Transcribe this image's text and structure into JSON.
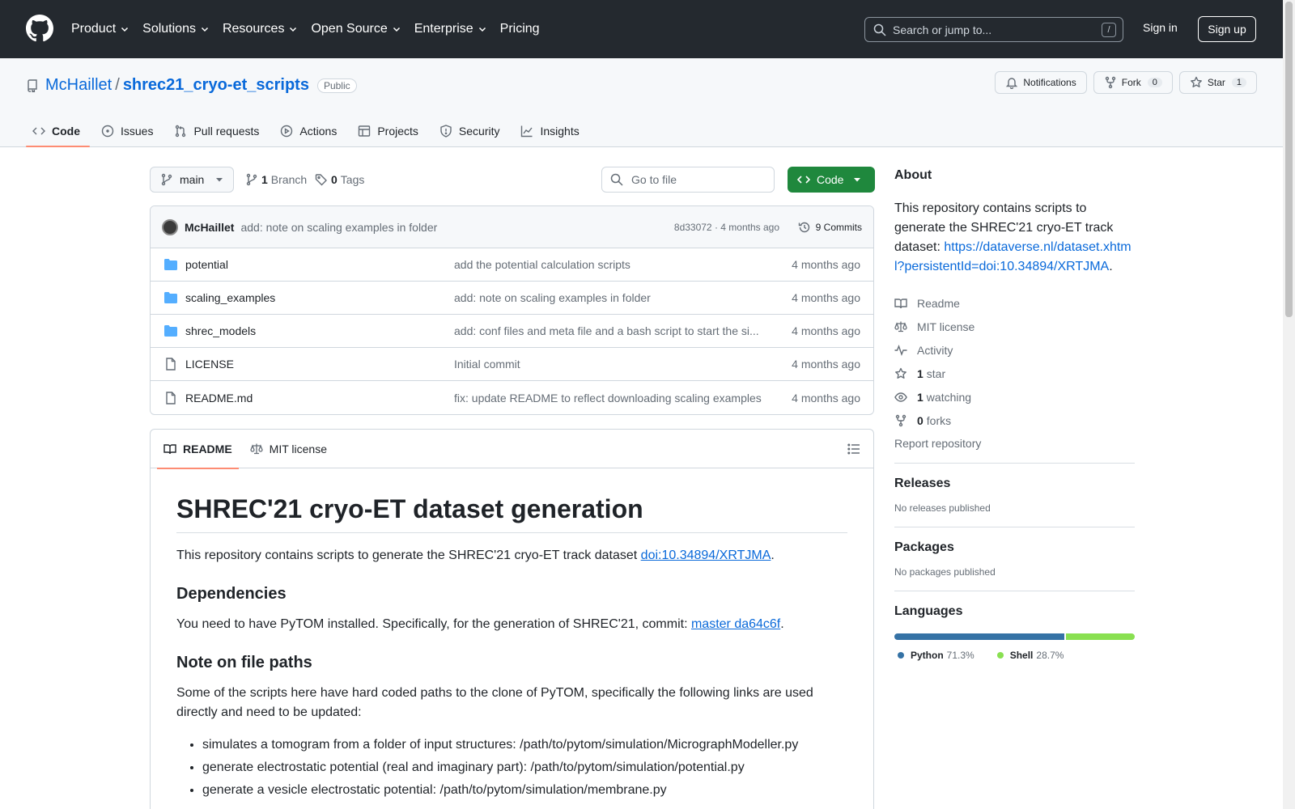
{
  "header": {
    "nav": [
      {
        "label": "Product",
        "dropdown": true
      },
      {
        "label": "Solutions",
        "dropdown": true
      },
      {
        "label": "Resources",
        "dropdown": true
      },
      {
        "label": "Open Source",
        "dropdown": true
      },
      {
        "label": "Enterprise",
        "dropdown": true
      },
      {
        "label": "Pricing",
        "dropdown": false
      }
    ],
    "search_placeholder": "Search or jump to...",
    "search_shortcut": "/",
    "sign_in": "Sign in",
    "sign_up": "Sign up"
  },
  "repo": {
    "owner": "McHaillet",
    "separator": "/",
    "name": "shrec21_cryo-et_scripts",
    "visibility": "Public",
    "actions": {
      "notifications": "Notifications",
      "fork_label": "Fork",
      "fork_count": "0",
      "star_label": "Star",
      "star_count": "1"
    },
    "tabs": [
      {
        "label": "Code",
        "icon": "code-icon",
        "active": true
      },
      {
        "label": "Issues",
        "icon": "issue-icon",
        "active": false
      },
      {
        "label": "Pull requests",
        "icon": "pull-request-icon",
        "active": false
      },
      {
        "label": "Actions",
        "icon": "play-icon",
        "active": false
      },
      {
        "label": "Projects",
        "icon": "table-icon",
        "active": false
      },
      {
        "label": "Security",
        "icon": "shield-icon",
        "active": false
      },
      {
        "label": "Insights",
        "icon": "graph-icon",
        "active": false
      }
    ]
  },
  "filebar": {
    "branch": "main",
    "branch_count": "1",
    "branch_label": "Branch",
    "tag_count": "0",
    "tag_label": "Tags",
    "go_to_file": "Go to file",
    "code_button": "Code"
  },
  "latest_commit": {
    "author": "McHaillet",
    "message": "add: note on scaling examples in folder",
    "hash_age": "8d33072 · 4 months ago",
    "commits": "9 Commits"
  },
  "files": [
    {
      "name": "potential",
      "type": "folder",
      "commit": "add the potential calculation scripts",
      "age": "4 months ago"
    },
    {
      "name": "scaling_examples",
      "type": "folder",
      "commit": "add: note on scaling examples in folder",
      "age": "4 months ago"
    },
    {
      "name": "shrec_models",
      "type": "folder",
      "commit": "add: conf files and meta file and a bash script to start the si...",
      "age": "4 months ago"
    },
    {
      "name": "LICENSE",
      "type": "file",
      "commit": "Initial commit",
      "age": "4 months ago"
    },
    {
      "name": "README.md",
      "type": "file",
      "commit": "fix: update README to reflect downloading scaling examples",
      "age": "4 months ago"
    }
  ],
  "readme": {
    "tab_readme": "README",
    "tab_license": "MIT license",
    "title": "SHREC'21 cryo-ET dataset generation",
    "intro_text": "This repository contains scripts to generate the SHREC'21 cryo-ET track dataset ",
    "intro_link": "doi:10.34894/XRTJMA",
    "intro_end": ".",
    "h_dependencies": "Dependencies",
    "dep_text": "You need to have PyTOM installed. Specifically, for the generation of SHREC'21, commit: ",
    "dep_link": "master da64c6f",
    "dep_end": ".",
    "h_paths": "Note on file paths",
    "paths_text": "Some of the scripts here have hard coded paths to the clone of PyTOM, specifically the following links are used directly and need to be updated:",
    "bullets": [
      "simulates a tomogram from a folder of input structures: /path/to/pytom/simulation/MicrographModeller.py",
      "generate electrostatic potential (real and imaginary part): /path/to/pytom/simulation/potential.py",
      "generate a vesicle electrostatic potential: /path/to/pytom/simulation/membrane.py"
    ]
  },
  "sidebar": {
    "about_title": "About",
    "about_text": "This repository contains scripts to generate the SHREC'21 cryo-ET track dataset: ",
    "about_link": "https://dataverse.nl/dataset.xhtml?persistentId=doi:10.34894/XRTJMA",
    "about_end": ".",
    "readme": "Readme",
    "license": "MIT license",
    "activity": "Activity",
    "stars_count": "1",
    "stars_label": "star",
    "watching_count": "1",
    "watching_label": "watching",
    "forks_count": "0",
    "forks_label": "forks",
    "report": "Report repository",
    "releases_title": "Releases",
    "releases_note": "No releases published",
    "packages_title": "Packages",
    "packages_note": "No packages published",
    "languages_title": "Languages",
    "languages": [
      {
        "name": "Python",
        "percent": "71.3%",
        "value": 71.3,
        "color": "#3572A5"
      },
      {
        "name": "Shell",
        "percent": "28.7%",
        "value": 28.7,
        "color": "#89e051"
      }
    ]
  }
}
